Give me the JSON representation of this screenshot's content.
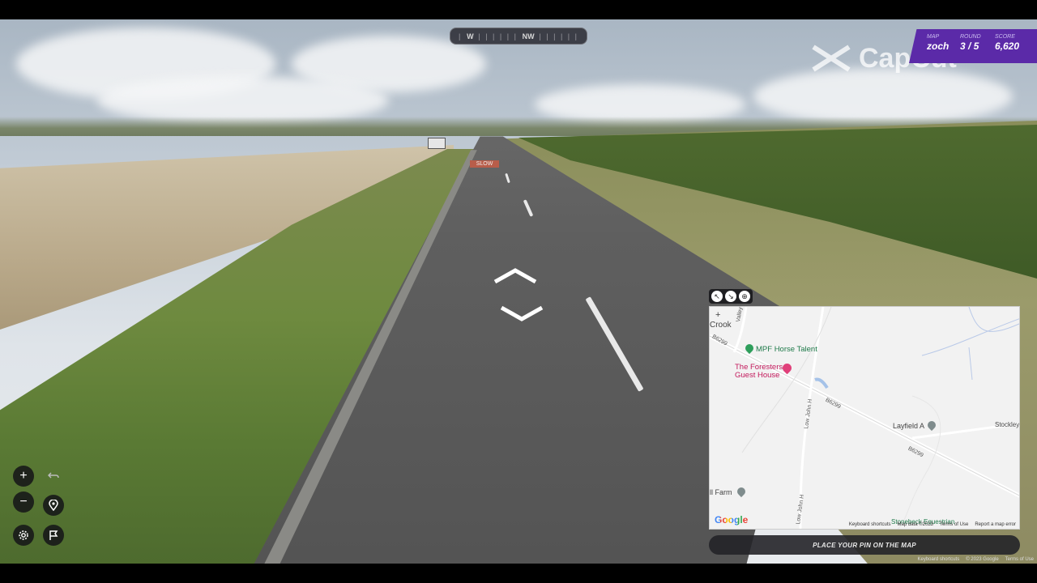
{
  "compass": {
    "left_heading": "W",
    "right_heading": "NW"
  },
  "status": {
    "map_label": "MAP",
    "map_value": "zoch",
    "round_label": "ROUND",
    "round_value": "3 / 5",
    "score_label": "SCORE",
    "score_value": "6,620"
  },
  "watermark": {
    "text": "CapCut"
  },
  "street_sign": {
    "text": ""
  },
  "road_marking": {
    "text": "SLOW"
  },
  "controls": {
    "zoom_in": "+",
    "zoom_out": "−",
    "undo_icon": "undo-icon",
    "checkpoint_icon": "map-pin-icon",
    "settings_icon": "gear-icon",
    "flag_icon": "flag-icon"
  },
  "minimap": {
    "tools": [
      "expand-icon",
      "shrink-icon",
      "pin-icon"
    ],
    "town_label": "Crook",
    "zoom_plus": "+",
    "poi_mpf": "MPF Horse Talent",
    "poi_foresters_1": "The Foresters",
    "poi_foresters_2": "Guest House",
    "poi_layfield": "Layfield A",
    "poi_stockley": "Stockley",
    "poi_farm": "ll Farm",
    "road_b6299_1": "B6299",
    "road_b6299_2": "B6299",
    "road_b6299_3": "B6299",
    "road_low_john": "Low John H",
    "road_low_john_2": "Low John H",
    "road_valley": "Valley Terrace",
    "poi_stonebeck": "Stonebeck Equestrian",
    "google": "Google",
    "footer": [
      "Keyboard shortcuts",
      "Map data ©2023",
      "Terms of Use",
      "Report a map error"
    ]
  },
  "pin_button": {
    "label": "PLACE YOUR PIN ON THE MAP"
  },
  "footer": [
    "Keyboard shortcuts",
    "© 2023 Google",
    "Terms of Use"
  ]
}
